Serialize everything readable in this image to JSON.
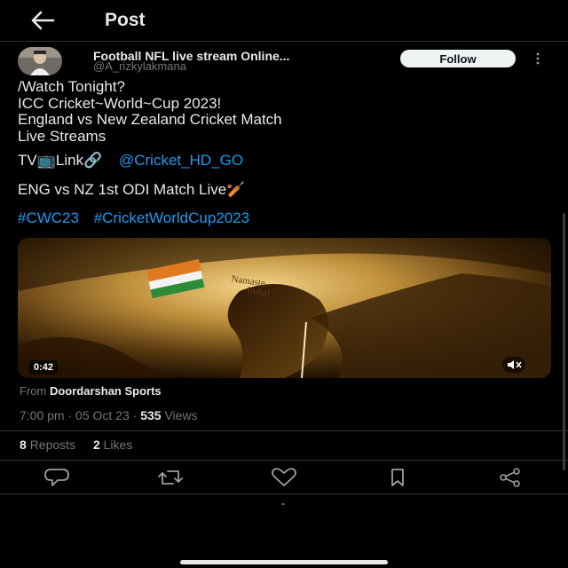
{
  "header": {
    "title": "Post"
  },
  "author": {
    "display_name": "Football NFL live stream Online...",
    "handle": "@A_rizkylakmana",
    "follow_label": "Follow"
  },
  "post": {
    "lines": [
      "/Watch  Tonight?",
      "ICC Cricket~World~Cup 2023!",
      "England vs New Zealand Cricket Match",
      "Live Streams"
    ],
    "tv_prefix": "TV📺Link🔗",
    "mention": "@Cricket_HD_GO",
    "match_line": "ENG vs NZ 1st ODI Match Live🏏",
    "hashtags": [
      "#CWC23",
      "#CricketWorldCup2023"
    ]
  },
  "media": {
    "duration": "0:42",
    "overlay_text_1": "Namaste",
    "overlay_text_2": "India!",
    "mute_icon": "volume-mute-icon"
  },
  "source": {
    "prefix": "From",
    "name": "Doordarshan Sports"
  },
  "meta": {
    "time": "7:00 pm",
    "separator": "·",
    "date": "05 Oct 23",
    "views_count": "535",
    "views_label": "Views"
  },
  "stats": {
    "reposts_count": "8",
    "reposts_label": "Reposts",
    "likes_count": "2",
    "likes_label": "Likes"
  },
  "actions": [
    "reply-icon",
    "repost-icon",
    "like-icon",
    "bookmark-icon",
    "share-icon"
  ],
  "colors": {
    "background": "#000000",
    "text": "#e7e9ea",
    "muted": "#71767b",
    "link": "#1d9bf0",
    "divider": "#2f3336"
  }
}
